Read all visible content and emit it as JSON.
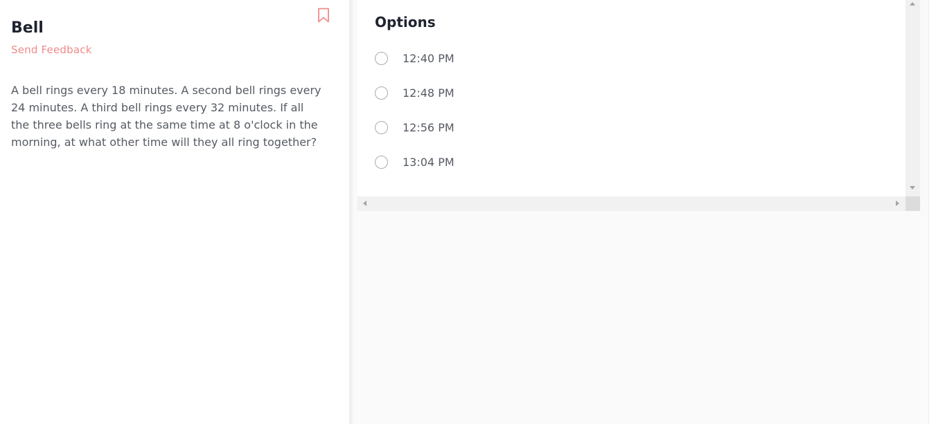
{
  "question": {
    "title": "Bell",
    "feedback_label": "Send Feedback",
    "bookmark_icon": "bookmark-icon",
    "text": "A bell rings every 18 minutes. A second bell rings every 24 minutes. A third bell rings every 32 minutes. If all the three bells ring at the same time at 8 o'clock in the morning, at what other time will they all ring together?"
  },
  "options": {
    "title": "Options",
    "items": [
      {
        "label": "12:40 PM",
        "selected": false
      },
      {
        "label": "12:48 PM",
        "selected": false
      },
      {
        "label": "12:56 PM",
        "selected": false
      },
      {
        "label": "13:04 PM",
        "selected": false
      }
    ]
  },
  "colors": {
    "accent": "#f08a8a",
    "heading": "#1f2330",
    "body_text": "#555a63"
  }
}
